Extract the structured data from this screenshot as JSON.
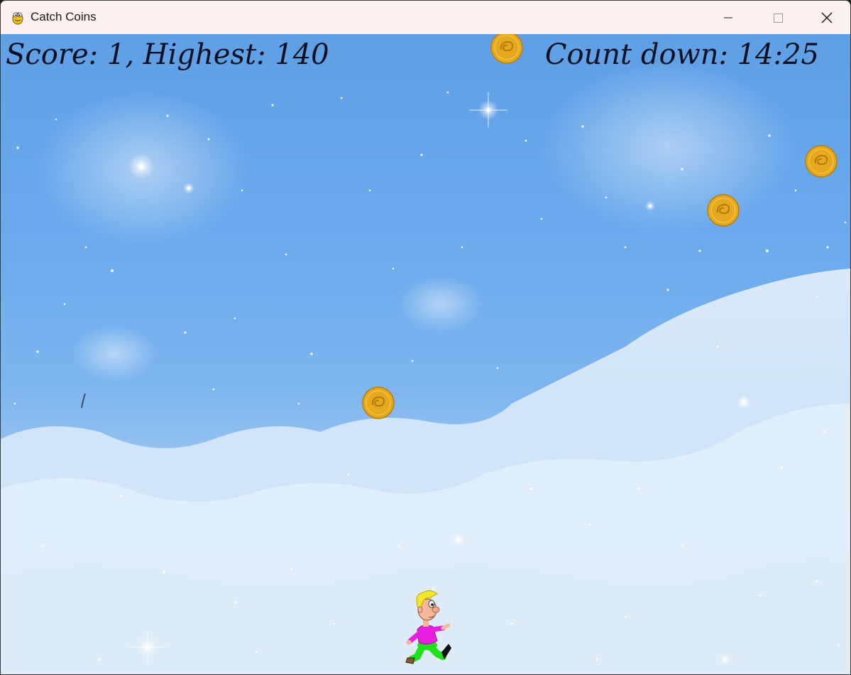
{
  "window": {
    "title": "Catch Coins",
    "icon": "pygame-snake-icon",
    "controls": {
      "minimize": "minimize-icon",
      "maximize": "maximize-icon",
      "close": "close-icon"
    }
  },
  "hud": {
    "score_text": "Score: 1, Highest: 140",
    "countdown_text": "Count down: 14:25"
  },
  "game": {
    "background": "starry-sky-with-clouds",
    "coin_count_visible": 4,
    "player": "running-boy-sprite"
  },
  "colors": {
    "titlebar": "#fbf1ef",
    "sky_top": "#5f9fe6",
    "sky_bottom": "#cfe3f6",
    "coin": "#e5a81e",
    "hud_text": "#0d1020",
    "player_shirt": "#e81ee0",
    "player_pants": "#22e01a",
    "player_hair": "#f3e72a"
  }
}
